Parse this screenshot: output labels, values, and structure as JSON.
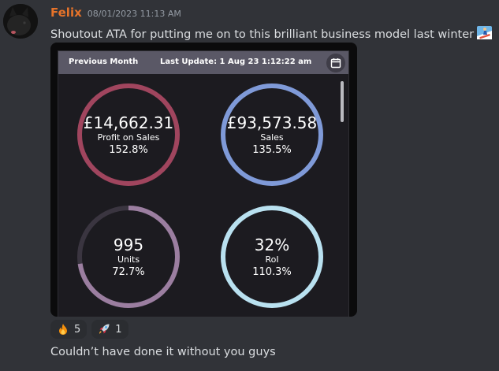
{
  "message": {
    "username": "Felix",
    "timestamp": "08/01/2023 11:13 AM",
    "text": "Shoutout ATA for putting me on to this brilliant business model last winter",
    "inline_emoji": "snowboarder-emoji",
    "followup": "Couldn’t have done it without you guys"
  },
  "dashboard": {
    "period": "Previous Month",
    "last_update": "Last Update: 1 Aug 23 1:12:22 am",
    "metrics": [
      {
        "value": "£14,662.31",
        "label": "Profit on Sales",
        "pct": "152.8%",
        "color": "#a0455e",
        "ring_fraction": 1.0
      },
      {
        "value": "£93,573.58",
        "label": "Sales",
        "pct": "135.5%",
        "color": "#7f9ad8",
        "ring_fraction": 1.0
      },
      {
        "value": "995",
        "label": "Units",
        "pct": "72.7%",
        "color": "#9b7ea0",
        "ring_fraction": 0.727
      },
      {
        "value": "32%",
        "label": "RoI",
        "pct": "110.3%",
        "color": "#b9e1f0",
        "ring_fraction": 1.0
      }
    ]
  },
  "reactions": [
    {
      "icon": "fire-emoji",
      "count": "5"
    },
    {
      "icon": "rocket-emoji",
      "count": "1"
    }
  ]
}
